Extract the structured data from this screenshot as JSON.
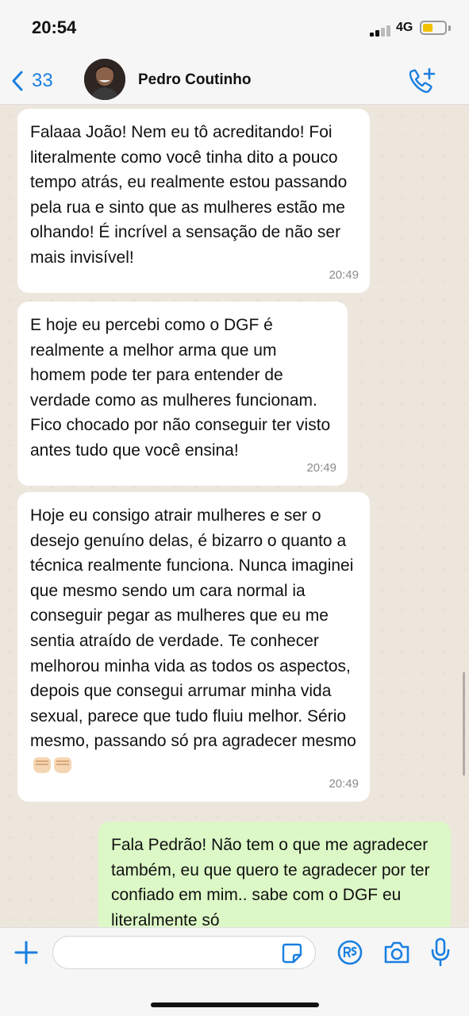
{
  "status_bar": {
    "time": "20:54",
    "network": "4G",
    "battery_level": 0.35,
    "battery_color": "#f2c200"
  },
  "header": {
    "back_count": "33",
    "contact_name": "Pedro Coutinho",
    "back_icon": "chevron-left-icon",
    "call_icon": "phone-plus-icon",
    "accent_color": "#1a7fe0"
  },
  "messages": [
    {
      "direction": "in",
      "text": "Falaaa João! Nem eu tô acreditando! Foi literalmente como você tinha dito a pouco tempo atrás, eu realmente estou passando pela rua e sinto que as mulheres estão me olhando! É incrível a sensação de não ser mais invisível!",
      "time": "20:49"
    },
    {
      "direction": "in",
      "text": "E hoje eu percebi como o DGF é realmente a melhor arma que um homem pode ter para entender de verdade como as mulheres funcionam. Fico chocado por não conseguir ter visto antes tudo que você ensina!",
      "time": "20:49"
    },
    {
      "direction": "in",
      "text": "Hoje eu consigo atrair mulheres e ser o desejo genuíno delas, é bizarro o quanto a técnica realmente funciona. Nunca imaginei que mesmo sendo um cara normal ia conseguir pegar as mulheres que eu me sentia atraído de verdade. Te conhecer melhorou minha vida as todos os aspectos, depois que consegui arrumar minha vida sexual, parece que tudo fluiu melhor. Sério mesmo, passando só pra agradecer mesmo",
      "emoji": "fist-bump-emoji",
      "time": "20:49"
    },
    {
      "direction": "out",
      "text": "Fala Pedrão! Não tem o que me agradecer também, eu que quero te agradecer por ter confiado em mim.. sabe com o DGF eu literalmente só"
    }
  ],
  "input_bar": {
    "placeholder": "",
    "icons": [
      "plus-icon",
      "sticker-icon",
      "payment-icon",
      "camera-icon",
      "microphone-icon"
    ]
  },
  "colors": {
    "incoming_bubble": "#ffffff",
    "outgoing_bubble": "#dcf8c6",
    "chat_background": "#ede6dd"
  }
}
